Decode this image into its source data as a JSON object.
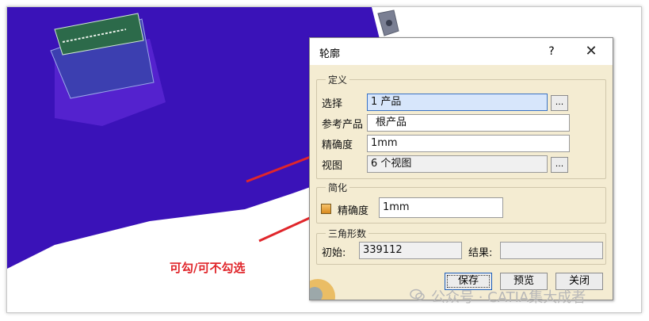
{
  "dialog": {
    "title": "轮廓",
    "help": "?",
    "close": "✕",
    "definition": {
      "legend": "定义",
      "select_label": "选择",
      "select_value": "1 产品",
      "ref_product_label": "参考产品",
      "ref_product_value": "根产品",
      "accuracy_label": "精确度",
      "accuracy_value": "1mm",
      "view_label": "视图",
      "view_value": "6 个视图",
      "browse": "..."
    },
    "simplify": {
      "legend": "简化",
      "accuracy_label": "精确度",
      "accuracy_value": "1mm"
    },
    "triangles": {
      "legend": "三角形数",
      "initial_label": "初始:",
      "initial_value": "339112",
      "result_label": "结果:",
      "result_value": ""
    },
    "buttons": {
      "save": "保存",
      "preview": "预览",
      "close": "关闭"
    }
  },
  "annotation": "可勾/可不勾选",
  "watermark": "公众号 · CATIA集大成者"
}
